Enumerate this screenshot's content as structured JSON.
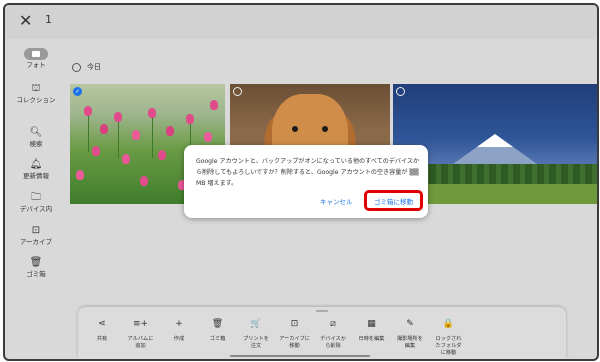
{
  "topbar": {
    "close_icon": "close-icon",
    "selected_count": "1"
  },
  "nav": {
    "items": [
      {
        "label": "フォト",
        "icon": "photo-icon",
        "active": true
      },
      {
        "label": "コレクション",
        "icon": "collection-icon"
      },
      {
        "label": "検索",
        "icon": "search-icon"
      },
      {
        "label": "更新情報",
        "icon": "bell-icon"
      },
      {
        "label": "デバイス内",
        "icon": "folder-icon"
      },
      {
        "label": "アーカイブ",
        "icon": "archive-icon"
      },
      {
        "label": "ゴミ箱",
        "icon": "trash-icon"
      }
    ]
  },
  "section": {
    "date_label": "今日"
  },
  "photos": [
    {
      "subject": "tulips",
      "selected": true
    },
    {
      "subject": "dog",
      "selected": false
    },
    {
      "subject": "mountain",
      "selected": false
    }
  ],
  "dialog": {
    "message": "Google アカウントと、バックアップがオンになっている他のすべてのデバイスから削除してもよろしいですか？削除すると、Google アカウントの空き容量が ▒▒ MB 増えます。",
    "cancel_label": "キャンセル",
    "confirm_label": "ゴミ箱に移動",
    "highlight_color": "#e00000"
  },
  "actions": [
    {
      "label": "共有",
      "icon": "share-icon",
      "glyph": "⋖"
    },
    {
      "label": "アルバムに\n追加",
      "icon": "add-to-album-icon",
      "glyph": "≡+"
    },
    {
      "label": "作成",
      "icon": "plus-icon",
      "glyph": "+"
    },
    {
      "label": "ゴミ箱",
      "icon": "trash-icon",
      "glyph": "🗑"
    },
    {
      "label": "プリントを\n注文",
      "icon": "cart-icon",
      "glyph": "🛒"
    },
    {
      "label": "アーカイブに\n移動",
      "icon": "archive-icon",
      "glyph": "⊡"
    },
    {
      "label": "デバイスか\nら削除",
      "icon": "device-remove-icon",
      "glyph": "⧄"
    },
    {
      "label": "日時を編集",
      "icon": "calendar-icon",
      "glyph": "▦"
    },
    {
      "label": "撮影場所を\n編集",
      "icon": "location-edit-icon",
      "glyph": "✎"
    },
    {
      "label": "ロックされ\nたフォルダ\nに移動",
      "icon": "lock-icon",
      "glyph": "🔒"
    }
  ]
}
